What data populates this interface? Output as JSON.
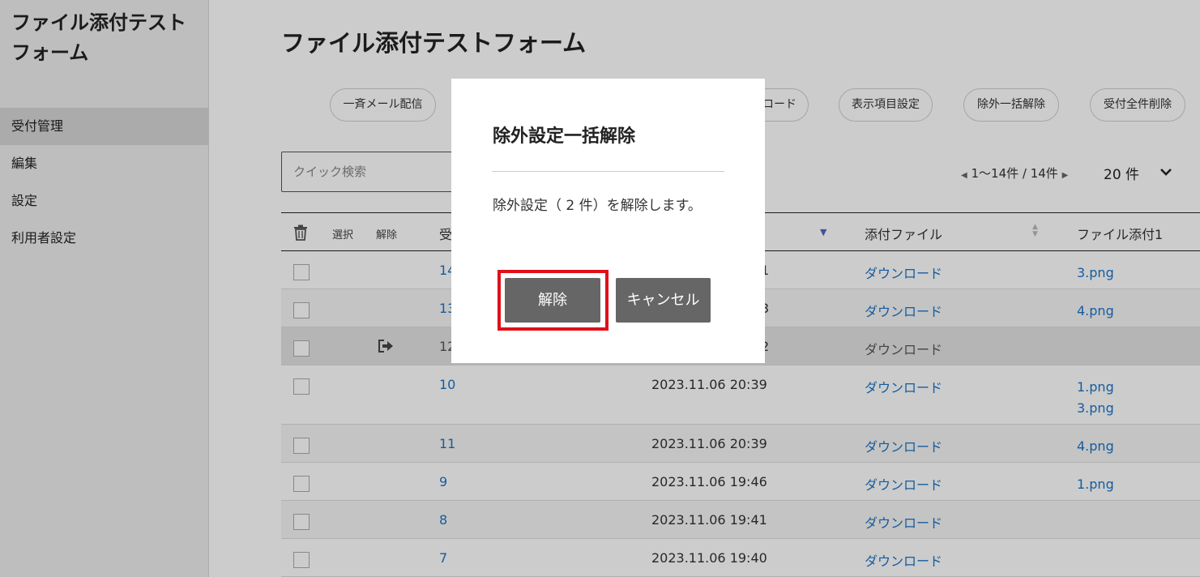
{
  "sidebar": {
    "app_title": "ファイル添付テストフォーム",
    "items": [
      {
        "label": "受付管理",
        "active": true
      },
      {
        "label": "編集"
      },
      {
        "label": "設定"
      },
      {
        "label": "利用者設定"
      }
    ]
  },
  "main": {
    "page_title": "ファイル添付テストフォーム",
    "toolbar": {
      "bulk_mail": "一斉メール配信",
      "download": "ロード",
      "display_settings": "表示項目設定",
      "bulk_unexclude": "除外一括解除",
      "delete_all": "受付全件削除"
    },
    "search_placeholder": "クイック検索",
    "pager_text": "1～14件 / 14件",
    "per_page": "20 件"
  },
  "table": {
    "headers": {
      "select": "選択",
      "unexclude": "解除",
      "number": "受",
      "attachment": "添付ファイル",
      "file1": "ファイル添付1"
    },
    "rows": [
      {
        "id": "14",
        "date": "1",
        "attachment": "ダウンロード",
        "files": [
          "3.png"
        ],
        "excluded": false
      },
      {
        "id": "13",
        "date": "3",
        "attachment": "ダウンロード",
        "files": [
          "4.png"
        ],
        "excluded": false
      },
      {
        "id": "12",
        "date": "2",
        "attachment": "ダウンロード",
        "files": [],
        "excluded": true
      },
      {
        "id": "10",
        "date": "2023.11.06 20:39",
        "attachment": "ダウンロード",
        "files": [
          "1.png",
          "3.png"
        ],
        "excluded": false
      },
      {
        "id": "11",
        "date": "2023.11.06 20:39",
        "attachment": "ダウンロード",
        "files": [
          "4.png"
        ],
        "excluded": false
      },
      {
        "id": "9",
        "date": "2023.11.06 19:46",
        "attachment": "ダウンロード",
        "files": [
          "1.png"
        ],
        "excluded": false
      },
      {
        "id": "8",
        "date": "2023.11.06 19:41",
        "attachment": "ダウンロード",
        "files": [],
        "excluded": false
      },
      {
        "id": "7",
        "date": "2023.11.06 19:40",
        "attachment": "ダウンロード",
        "files": [],
        "excluded": false
      }
    ]
  },
  "modal": {
    "title": "除外設定一括解除",
    "message": "除外設定（ 2 件）を解除します。",
    "confirm_label": "解除",
    "cancel_label": "キャンセル"
  },
  "colors": {
    "link": "#1a73c7",
    "button": "#666666",
    "highlight": "#e0101a"
  }
}
